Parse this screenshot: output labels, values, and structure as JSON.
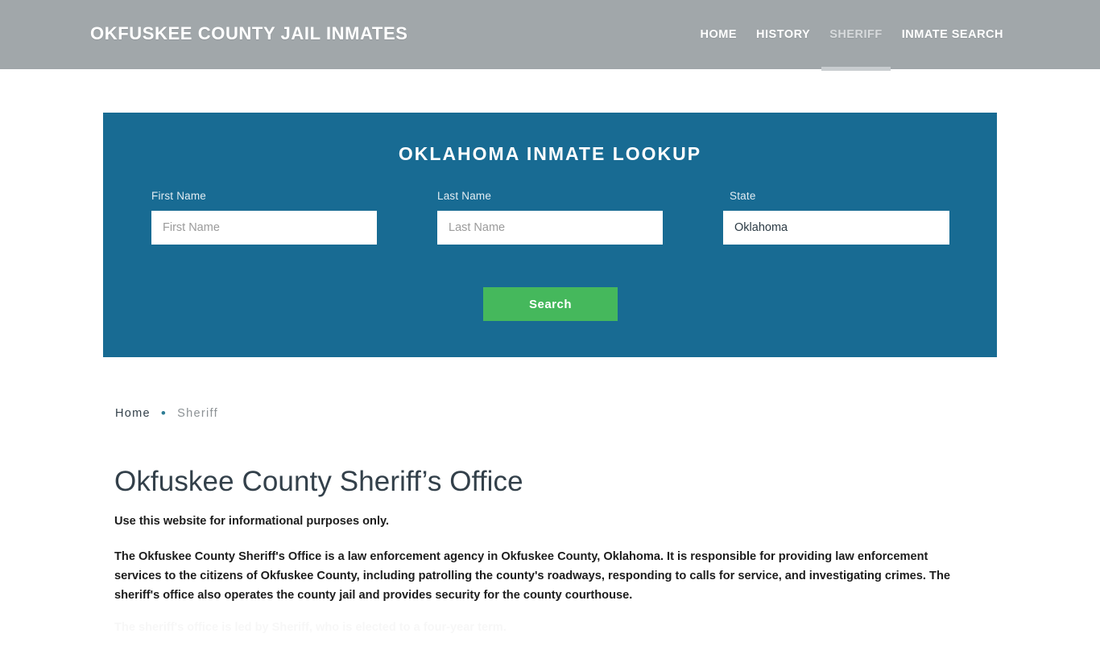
{
  "header": {
    "site_title": "OKFUSKEE COUNTY JAIL INMATES",
    "nav": [
      {
        "label": "HOME",
        "active": false
      },
      {
        "label": "HISTORY",
        "active": false
      },
      {
        "label": "SHERIFF",
        "active": true
      },
      {
        "label": "INMATE SEARCH",
        "active": false
      }
    ],
    "background_color": "#a1a7aa"
  },
  "lookup": {
    "title": "OKLAHOMA INMATE LOOKUP",
    "panel_color": "#186b93",
    "first_name": {
      "label": "First Name",
      "placeholder": "First Name",
      "value": ""
    },
    "last_name": {
      "label": "Last Name",
      "placeholder": "Last Name",
      "value": ""
    },
    "state": {
      "label": "State",
      "value": "Oklahoma"
    },
    "search_button": {
      "label": "Search",
      "color": "#45b85c"
    }
  },
  "breadcrumb": {
    "home": "Home",
    "separator": "•",
    "current": "Sheriff"
  },
  "content": {
    "page_title": "Okfuskee County Sheriff’s Office",
    "lead": "Use this website for informational purposes only.",
    "paragraph": "The Okfuskee County Sheriff's Office is a law enforcement agency in Okfuskee County, Oklahoma. It is responsible for providing law enforcement services to the citizens of Okfuskee County, including patrolling the county's roadways, responding to calls for service, and investigating crimes. The sheriff's office also operates the county jail and provides security for the county courthouse.",
    "next_paragraph_clipped": "The sheriff's office is led by Sheriff, who is elected to a four-year term."
  }
}
